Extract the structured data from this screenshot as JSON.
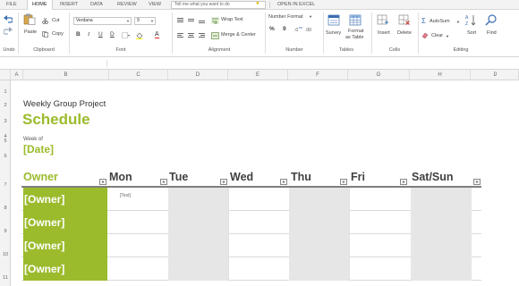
{
  "tabs": [
    "FILE",
    "HOME",
    "INSERT",
    "DATA",
    "REVIEW",
    "VIEW"
  ],
  "tell_me": "Tell me what you want to do",
  "open_in_excel": "OPEN IN EXCEL",
  "ribbon": {
    "undo": "Undo",
    "paste": "Paste",
    "cut": "Cut",
    "copy": "Copy",
    "clipboard": "Clipboard",
    "font_name": "Verdana",
    "font_size": "9",
    "bold": "B",
    "italic": "I",
    "underline": "U",
    "double_underline": "D",
    "font_color": "A",
    "font": "Font",
    "wrap_text": "Wrap Text",
    "merge_center": "Merge & Center",
    "alignment": "Alignment",
    "number_format": "Number Format",
    "percent": "%",
    "comma": "9",
    "number": "Number",
    "survey": "Survey",
    "format_as_table_1": "Format",
    "format_as_table_2": "as Table",
    "tables": "Tables",
    "insert": "Insert",
    "delete": "Delete",
    "cells": "Cells",
    "autosum": "AutoSum",
    "clear": "Clear",
    "sort": "Sort",
    "find": "Find",
    "editing": "Editing"
  },
  "columns": [
    "A",
    "B",
    "C",
    "D",
    "E",
    "F",
    "G",
    "H",
    "I",
    "J"
  ],
  "rows": [
    "1",
    "2",
    "3",
    "4",
    "5",
    "6",
    "7",
    "8",
    "9",
    "10",
    "11"
  ],
  "sheet": {
    "weekly_label": "Weekly  Group Project",
    "title": "Schedule",
    "week_of": "Week of",
    "date": "[Date]",
    "headers": [
      "Owner",
      "Mon",
      "Tue",
      "Wed",
      "Thu",
      "Fri",
      "Sat/Sun"
    ],
    "owners": [
      "[Owner]",
      "[Owner]",
      "[Owner]",
      "[Owner]"
    ],
    "first_cell_text": "[Text]"
  },
  "colors": {
    "accent_green": "#9bbb2c",
    "shade_gray": "#e6e6e6"
  }
}
